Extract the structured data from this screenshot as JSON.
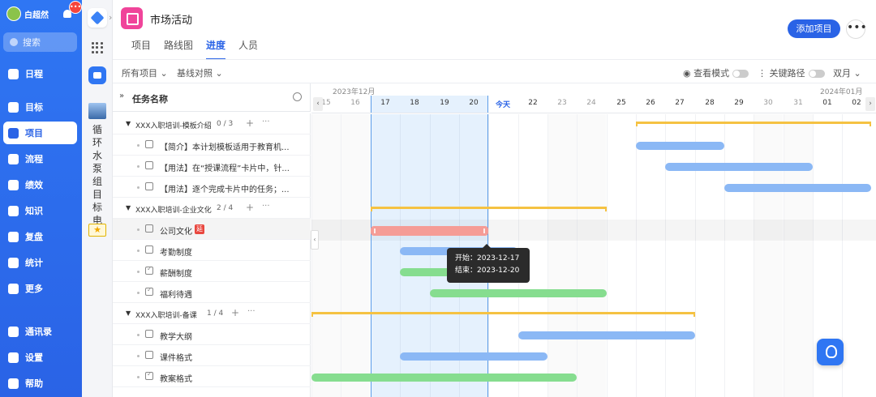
{
  "sidebar": {
    "username": "白超然",
    "badge": "•••",
    "search_placeholder": "搜索",
    "items": [
      {
        "label": "日程",
        "icon": "calendar-icon"
      },
      {
        "label": "目标",
        "icon": "target-icon"
      },
      {
        "label": "项目",
        "icon": "cube-icon",
        "active": true
      },
      {
        "label": "流程",
        "icon": "flow-icon"
      },
      {
        "label": "绩效",
        "icon": "performance-icon"
      },
      {
        "label": "知识",
        "icon": "book-icon"
      },
      {
        "label": "复盘",
        "icon": "review-icon"
      },
      {
        "label": "统计",
        "icon": "pie-chart-icon"
      },
      {
        "label": "更多",
        "icon": "grid-icon"
      }
    ],
    "bottom_items": [
      {
        "label": "通讯录",
        "icon": "contacts-icon"
      },
      {
        "label": "设置",
        "icon": "gear-icon"
      },
      {
        "label": "帮助",
        "icon": "help-icon"
      }
    ]
  },
  "col2": {
    "vertical_text": "循环水泵组目标电",
    "star": "★"
  },
  "header": {
    "title": "市场活动",
    "tabs": [
      {
        "label": "项目"
      },
      {
        "label": "路线图"
      },
      {
        "label": "进度",
        "active": true
      },
      {
        "label": "人员"
      }
    ],
    "add_button": "添加项目",
    "more": "•••"
  },
  "filters": {
    "all_projects": "所有项目",
    "baseline": "基线对照",
    "view_mode": "查看模式",
    "critical_path": "关键路径",
    "scale": "双月"
  },
  "task_list": {
    "header": "任务名称",
    "groups": [
      {
        "name": "XXX入职培训-模板介绍",
        "count": "0 / 3",
        "tasks": [
          {
            "name": "【简介】本计划模板适用于教育机...",
            "done": false
          },
          {
            "name": "【用法】在“授课流程”卡片中，针...",
            "done": false
          },
          {
            "name": "【用法】逐个完成卡片中的任务；...",
            "done": false
          }
        ]
      },
      {
        "name": "XXX入职培训-企业文化",
        "count": "2 / 4",
        "tasks": [
          {
            "name": "公司文化",
            "done": false,
            "late": "延"
          },
          {
            "name": "考勤制度",
            "done": false
          },
          {
            "name": "薪酬制度",
            "done": true
          },
          {
            "name": "福利待遇",
            "done": true
          }
        ]
      },
      {
        "name": "XXX入职培训-备课",
        "count": "1 / 4",
        "tasks": [
          {
            "name": "教学大纲",
            "done": false
          },
          {
            "name": "课件格式",
            "done": false
          },
          {
            "name": "教案格式",
            "done": true
          }
        ]
      }
    ]
  },
  "gantt": {
    "months": [
      "2023年12月",
      "2024年01月"
    ],
    "days": [
      "15",
      "16",
      "17",
      "18",
      "19",
      "20",
      "今天",
      "22",
      "23",
      "24",
      "25",
      "26",
      "27",
      "28",
      "29",
      "30",
      "31",
      "01",
      "02"
    ],
    "tooltip": {
      "start": "开始：2023-12-17",
      "end": "结束：2023-12-20"
    }
  }
}
